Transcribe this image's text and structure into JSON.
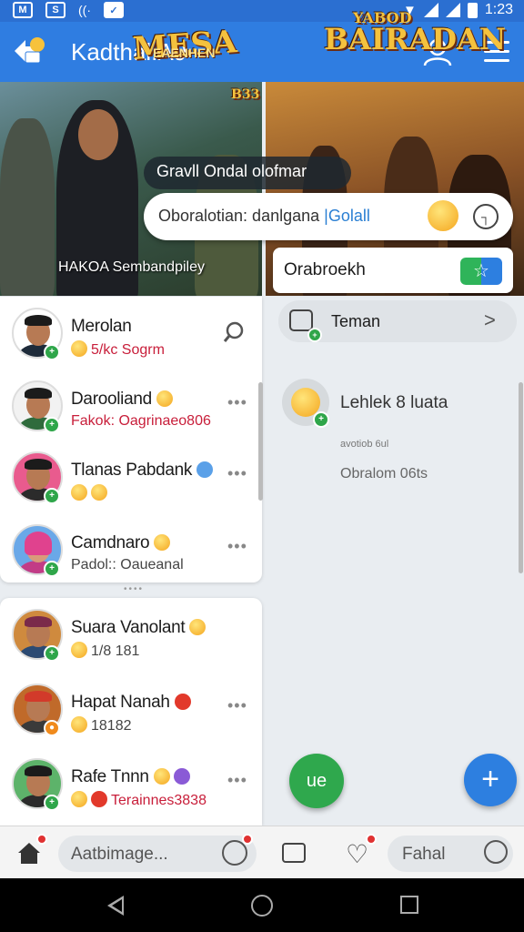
{
  "status_bar": {
    "time": "1:23",
    "left_icons": [
      "M",
      "S",
      "wifi-signal-icon",
      "image-icon"
    ]
  },
  "app_bar": {
    "title": "Kadthal.A9",
    "icons": [
      "logo-icon",
      "user-icon",
      "menu-icon"
    ]
  },
  "banner": {
    "left_title": "MESA",
    "left_subtitle": "EAENHEN",
    "left_corner": "B33",
    "right_small": "YABOD",
    "right_title": "BAIRADAN",
    "caption": "HAKOA Sembandpiley"
  },
  "overlay": {
    "tooltip": "Gravll Ondal olofmar",
    "search_text": "Oboralotian: danlgana",
    "search_accent": "|Golall",
    "card_text": "Orabroekh"
  },
  "chats_top": [
    {
      "name": "Merolan",
      "message": "5/kc Sogrm",
      "badge": "green",
      "trailing": "search"
    },
    {
      "name": "Darooliand",
      "message": "Fakok: Oagrinaeo806",
      "badge": "green",
      "trailing": "more"
    },
    {
      "name": "Tlanas Pabdank",
      "message": "",
      "badge": "green",
      "trailing": "more"
    },
    {
      "name": "Camdnaro",
      "message": "Padol:: Oaueanal",
      "badge": "green",
      "trailing": "more"
    }
  ],
  "chats_bottom": [
    {
      "name": "Suara Vanolant",
      "message": "1/8 181",
      "badge": "green",
      "trailing": ""
    },
    {
      "name": "Hapat Nanah",
      "message": "18182",
      "badge": "orange",
      "trailing": "more"
    },
    {
      "name": "Rafe Tnnn",
      "message": "Terainnes3838",
      "badge": "green",
      "trailing": "more"
    }
  ],
  "right_pane": {
    "teman_label": "Teman",
    "item_title": "Lehlek 8 luata",
    "item_sub1": "avotiob 6ul",
    "item_sub2": "Obralom 06ts"
  },
  "fabs": {
    "green_label": "ue",
    "blue_label": "+"
  },
  "bottom_bar": {
    "compose_placeholder": "Aatbimage...",
    "fahal_label": "Fahal"
  },
  "colors": {
    "primary": "#2f7de1",
    "status_bar": "#2b6fd1",
    "green": "#2fa84d",
    "badge_orange": "#f08a1c",
    "notif_red": "#e03131"
  }
}
